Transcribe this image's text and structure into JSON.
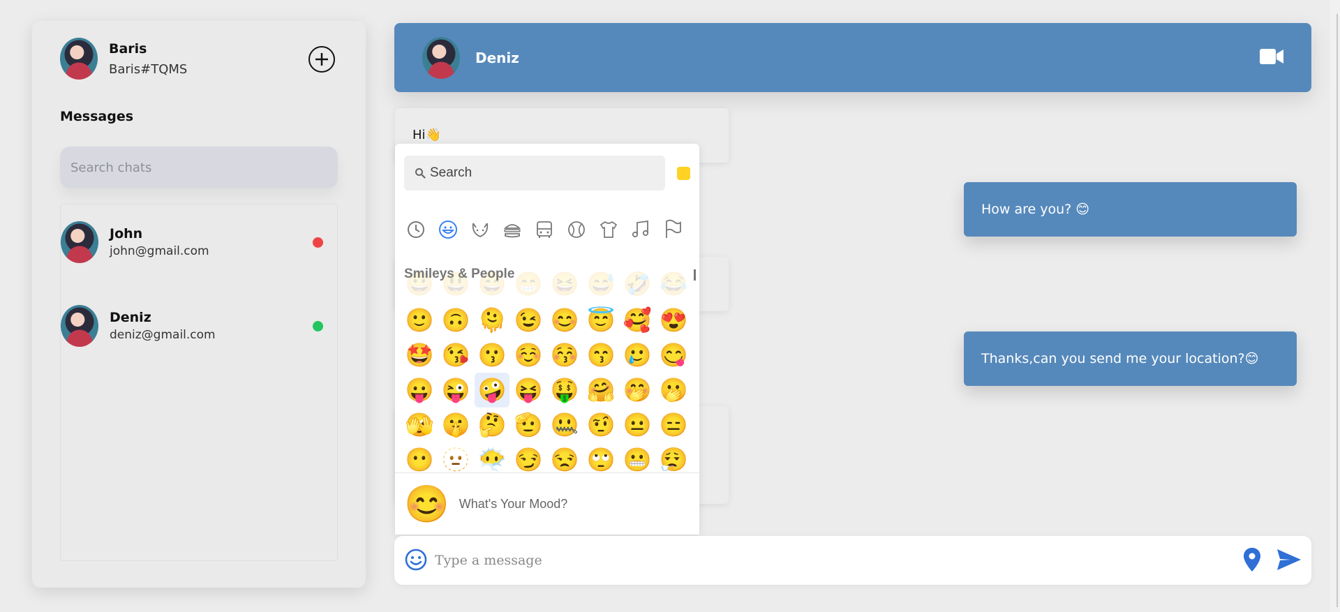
{
  "profile": {
    "name": "Baris",
    "tag": "Baris#TQMS"
  },
  "sidebar": {
    "messages_title": "Messages",
    "search_placeholder": "Search chats",
    "chats": [
      {
        "name": "John",
        "email": "john@gmail.com",
        "status_color": "#ef4444"
      },
      {
        "name": "Deniz",
        "email": "deniz@gmail.com",
        "status_color": "#22c55e"
      }
    ]
  },
  "header": {
    "name": "Deniz"
  },
  "messages": [
    {
      "direction": "in",
      "text": "Hi👋"
    },
    {
      "direction": "out",
      "text": "How are you? 😊"
    },
    {
      "direction": "out",
      "text": "Thanks,can you send me your location?😊"
    }
  ],
  "emoji_picker": {
    "search_placeholder": "Search",
    "section_title": "Smileys & People",
    "categories": [
      "recent",
      "smileys",
      "animals",
      "food",
      "travel",
      "activities",
      "objects",
      "symbols",
      "flags"
    ],
    "faded_row": [
      "😀",
      "😃",
      "😄",
      "😁",
      "😆",
      "😅",
      "🤣",
      "😂"
    ],
    "rows": [
      [
        "🙂",
        "🙃",
        "🫠",
        "😉",
        "😊",
        "😇",
        "🥰",
        "😍"
      ],
      [
        "🤩",
        "😘",
        "😗",
        "☺️",
        "😚",
        "😙",
        "🥲",
        "😋"
      ],
      [
        "😛",
        "😜",
        "🤪",
        "😝",
        "🤑",
        "🤗",
        "🤭",
        "🫢"
      ],
      [
        "🫣",
        "🤫",
        "🤔",
        "🫡",
        "🤐",
        "🤨",
        "😐",
        "😑"
      ],
      [
        "😶",
        "🫥",
        "😶‍🌫️",
        "😏",
        "😒",
        "🙄",
        "😬",
        "😮‍💨"
      ]
    ],
    "selected": "🤪",
    "footer_emoji": "😊",
    "footer_text": "What's Your Mood?",
    "accent": "#ffd225"
  },
  "composer": {
    "placeholder": "Type a message"
  },
  "colors": {
    "primary": "#5689bb",
    "icon_blue": "#2f6fd6"
  }
}
